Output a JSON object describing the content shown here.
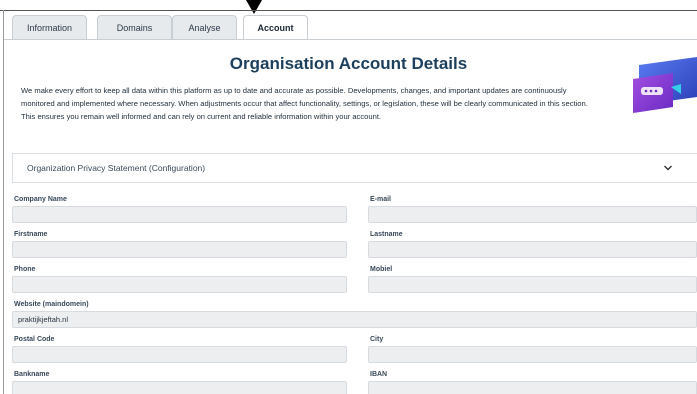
{
  "tabs": [
    {
      "label": "Information"
    },
    {
      "label": "Domains"
    },
    {
      "label": "Analyse"
    },
    {
      "label": "Account"
    }
  ],
  "page": {
    "title": "Organisation Account Details",
    "description": "We make every effort to keep all data within this platform as up to date and accurate as possible. Developments, changes, and important updates are continuously monitored and implemented where necessary. When adjustments occur that affect functionality, settings, or legislation, these will be clearly communicated in this section. This ensures you remain well informed and can rely on current and reliable information within your account."
  },
  "accordion": {
    "label": "Organization Privacy Statement (Configuration)"
  },
  "form": {
    "company_name": {
      "label": "Company Name",
      "value": ""
    },
    "email": {
      "label": "E-mail",
      "value": ""
    },
    "firstname": {
      "label": "Firstname",
      "value": ""
    },
    "lastname": {
      "label": "Lastname",
      "value": ""
    },
    "phone": {
      "label": "Phone",
      "value": ""
    },
    "mobile": {
      "label": "Mobiel",
      "value": ""
    },
    "website": {
      "label": "Website (maindomein)",
      "value": "praktijkjeftah.nl"
    },
    "postal_code": {
      "label": "Postal Code",
      "value": ""
    },
    "city": {
      "label": "City",
      "value": ""
    },
    "bankname": {
      "label": "Bankname",
      "value": ""
    },
    "iban": {
      "label": "IBAN",
      "value": ""
    }
  }
}
